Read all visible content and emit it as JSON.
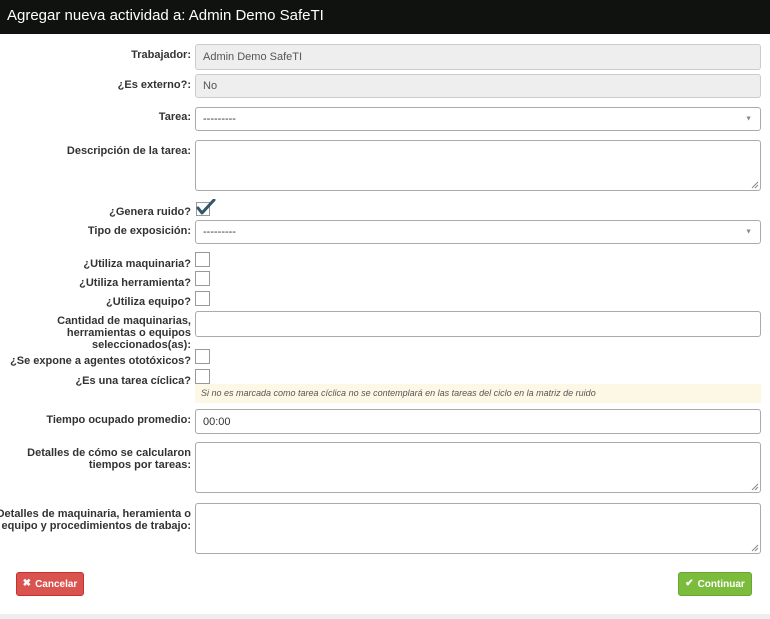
{
  "header": {
    "title": "Agregar nueva actividad a: Admin Demo SafeTI"
  },
  "form": {
    "trabajador": {
      "label": "Trabajador:",
      "value": "Admin Demo SafeTI"
    },
    "es_externo": {
      "label": "¿Es externo?:",
      "value": "No"
    },
    "tarea": {
      "label": "Tarea:",
      "value": "---------"
    },
    "descripcion": {
      "label": "Descripción de la tarea:",
      "value": ""
    },
    "genera_ruido": {
      "label": "¿Genera ruido?",
      "checked": true
    },
    "tipo_exposicion": {
      "label": "Tipo de exposición:",
      "value": "---------"
    },
    "utiliza_maquinaria": {
      "label": "¿Utiliza maquinaria?",
      "checked": false
    },
    "utiliza_herramienta": {
      "label": "¿Utiliza herramienta?",
      "checked": false
    },
    "utiliza_equipo": {
      "label": "¿Utiliza equipo?",
      "checked": false
    },
    "cantidad": {
      "label_lines": [
        "Cantidad de maquinarias,",
        "herramientas o equipos",
        "seleccionados(as):"
      ],
      "value": ""
    },
    "agentes_ototoxicos": {
      "label": "¿Se expone a agentes ototóxicos?",
      "checked": false
    },
    "tarea_ciclica": {
      "label": "¿Es una tarea cíclica?",
      "checked": false,
      "hint": "Si no es marcada como tarea cíclica no se contemplará en las tareas del ciclo en la matriz de ruido"
    },
    "tiempo_ocupado": {
      "label": "Tiempo ocupado promedio:",
      "value": "00:00"
    },
    "detalles_tiempos": {
      "label_lines": [
        "Detalles de cómo se calcularon",
        "tiempos por tareas:"
      ],
      "value": ""
    },
    "detalles_maquinaria": {
      "label_lines": [
        "Detalles de maquinaria, heramienta o",
        "equipo y procedimientos de trabajo:"
      ],
      "value": ""
    }
  },
  "buttons": {
    "cancel": "Cancelar",
    "continue": "Continuar"
  },
  "icons": {
    "cancel": "close-icon",
    "continue": "check-icon"
  },
  "colors": {
    "header_bg": "#0f120f",
    "cancel": "#d9534f",
    "continue": "#7cbc3c",
    "hint_bg": "#fdf8e6"
  }
}
